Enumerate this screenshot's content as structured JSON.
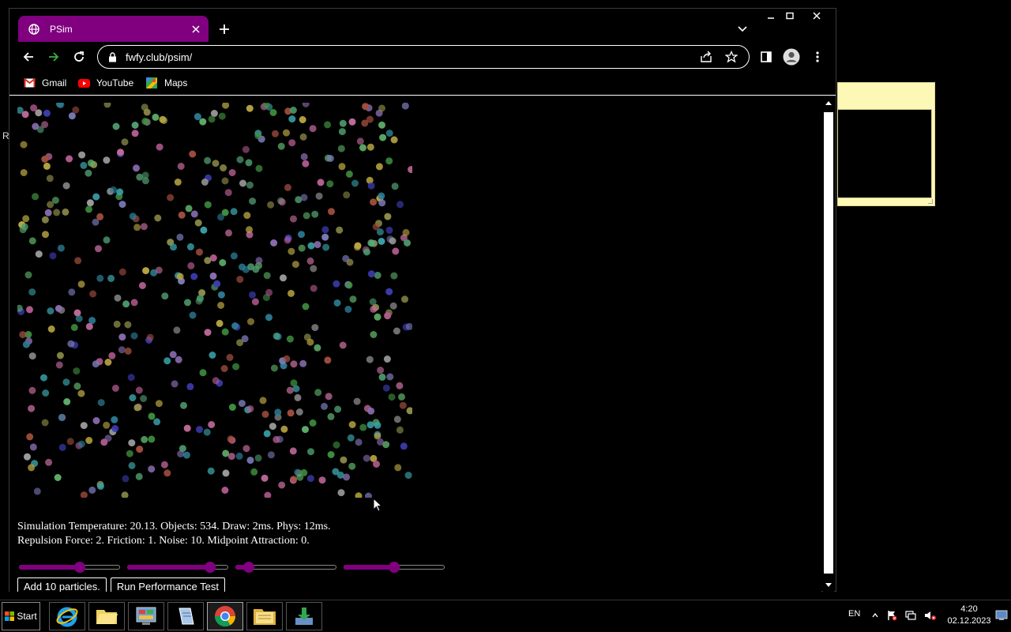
{
  "browser": {
    "tab_title": "PSim",
    "url": "fwfy.club/psim/",
    "bookmarks": [
      {
        "label": "Gmail",
        "icon": "gmail-icon"
      },
      {
        "label": "YouTube",
        "icon": "youtube-icon"
      },
      {
        "label": "Maps",
        "icon": "maps-icon"
      }
    ],
    "accent_color": "#800080"
  },
  "page": {
    "stats_line1": "Simulation Temperature: 20.13. Objects: 534. Draw: 2ms. Phys: 12ms.",
    "stats_line2": "Repulsion Force: 2. Friction: 1. Noise: 10. Midpoint Attraction: 0.",
    "sliders": [
      {
        "name": "repulsion-force-slider",
        "value": 0.6
      },
      {
        "name": "friction-slider",
        "value": 0.82
      },
      {
        "name": "noise-slider",
        "value": 0.13
      },
      {
        "name": "midpoint-attraction-slider",
        "value": 0.5
      }
    ],
    "buttons": {
      "add_particles": "Add 10 particles.",
      "performance_test": "Run Performance Test"
    }
  },
  "desktop": {
    "edge_letter": "R"
  },
  "taskbar": {
    "start_label": "Start",
    "apps": [
      "internet-explorer-icon",
      "folder-icon",
      "control-panel-icon",
      "notepad-icon",
      "chrome-icon",
      "file-explorer-icon",
      "download-icon"
    ],
    "language": "EN",
    "time": "4:20",
    "date": "02.12.2023"
  }
}
